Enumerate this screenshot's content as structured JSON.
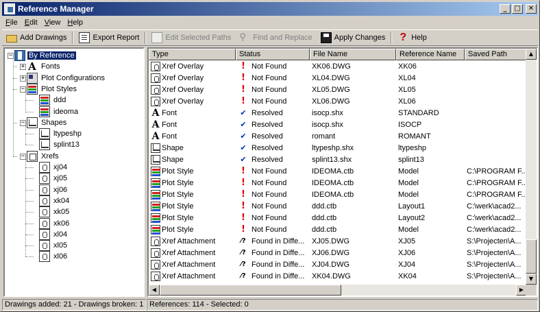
{
  "window": {
    "title": "Reference Manager",
    "minimize": "_",
    "maximize": "□",
    "close": "✕"
  },
  "menu": [
    {
      "label": "File",
      "u": "F",
      "rest": "ile"
    },
    {
      "label": "Edit",
      "u": "E",
      "rest": "dit"
    },
    {
      "label": "View",
      "u": "V",
      "rest": "iew"
    },
    {
      "label": "Help",
      "u": "H",
      "rest": "elp"
    }
  ],
  "toolbar": {
    "add_drawings": "Add Drawings",
    "export_report": "Export Report",
    "edit_paths": "Edit Selected Paths",
    "find_replace": "Find and Replace",
    "apply_changes": "Apply Changes",
    "help": "Help"
  },
  "tree": [
    {
      "label": "By Reference",
      "level": 0,
      "exp": "−",
      "icon": "ref",
      "selected": true
    },
    {
      "label": "Fonts",
      "level": 1,
      "exp": "+",
      "icon": "font"
    },
    {
      "label": "Plot Configurations",
      "level": 1,
      "exp": "+",
      "icon": "plotcfg"
    },
    {
      "label": "Plot Styles",
      "level": 1,
      "exp": "−",
      "icon": "pstyle"
    },
    {
      "label": "ddd",
      "level": 2,
      "icon": "pstyle"
    },
    {
      "label": "ideoma",
      "level": 2,
      "icon": "pstyle"
    },
    {
      "label": "Shapes",
      "level": 1,
      "exp": "−",
      "icon": "shape"
    },
    {
      "label": "ltypeshp",
      "level": 2,
      "icon": "shape"
    },
    {
      "label": "splint13",
      "level": 2,
      "icon": "shape"
    },
    {
      "label": "Xrefs",
      "level": 1,
      "exp": "−",
      "icon": "xrefs"
    },
    {
      "label": "xj04",
      "level": 2,
      "icon": "xref"
    },
    {
      "label": "xj05",
      "level": 2,
      "icon": "xref"
    },
    {
      "label": "xj06",
      "level": 2,
      "icon": "xref"
    },
    {
      "label": "xk04",
      "level": 2,
      "icon": "xref"
    },
    {
      "label": "xk05",
      "level": 2,
      "icon": "xref"
    },
    {
      "label": "xk06",
      "level": 2,
      "icon": "xref"
    },
    {
      "label": "xl04",
      "level": 2,
      "icon": "xref"
    },
    {
      "label": "xl05",
      "level": 2,
      "icon": "xref"
    },
    {
      "label": "xl06",
      "level": 2,
      "icon": "xref"
    }
  ],
  "columns": [
    "Type",
    "Status",
    "File Name",
    "Reference Name",
    "Saved Path"
  ],
  "rows": [
    {
      "type": "Xref Overlay",
      "icon": "xref",
      "status": "Not Found",
      "st": "notfound",
      "file": "XK06.DWG",
      "ref": "XK06",
      "path": ""
    },
    {
      "type": "Xref Overlay",
      "icon": "xref",
      "status": "Not Found",
      "st": "notfound",
      "file": "XL04.DWG",
      "ref": "XL04",
      "path": ""
    },
    {
      "type": "Xref Overlay",
      "icon": "xref",
      "status": "Not Found",
      "st": "notfound",
      "file": "XL05.DWG",
      "ref": "XL05",
      "path": ""
    },
    {
      "type": "Xref Overlay",
      "icon": "xref",
      "status": "Not Found",
      "st": "notfound",
      "file": "XL06.DWG",
      "ref": "XL06",
      "path": ""
    },
    {
      "type": "Font",
      "icon": "font",
      "status": "Resolved",
      "st": "resolved",
      "file": "isocp.shx",
      "ref": "STANDARD",
      "path": ""
    },
    {
      "type": "Font",
      "icon": "font",
      "status": "Resolved",
      "st": "resolved",
      "file": "isocp.shx",
      "ref": "ISOCP",
      "path": ""
    },
    {
      "type": "Font",
      "icon": "font",
      "status": "Resolved",
      "st": "resolved",
      "file": "romant",
      "ref": "ROMANT",
      "path": ""
    },
    {
      "type": "Shape",
      "icon": "shape",
      "status": "Resolved",
      "st": "resolved",
      "file": "ltypeshp.shx",
      "ref": "ltypeshp",
      "path": ""
    },
    {
      "type": "Shape",
      "icon": "shape",
      "status": "Resolved",
      "st": "resolved",
      "file": "splint13.shx",
      "ref": "splint13",
      "path": ""
    },
    {
      "type": "Plot Style",
      "icon": "pstyle",
      "status": "Not Found",
      "st": "notfound",
      "file": "IDEOMA.ctb",
      "ref": "Model",
      "path": "C:\\PROGRAM F..."
    },
    {
      "type": "Plot Style",
      "icon": "pstyle",
      "status": "Not Found",
      "st": "notfound",
      "file": "IDEOMA.ctb",
      "ref": "Model",
      "path": "C:\\PROGRAM F..."
    },
    {
      "type": "Plot Style",
      "icon": "pstyle",
      "status": "Not Found",
      "st": "notfound",
      "file": "IDEOMA.ctb",
      "ref": "Model",
      "path": "C:\\PROGRAM F..."
    },
    {
      "type": "Plot Style",
      "icon": "pstyle",
      "status": "Not Found",
      "st": "notfound",
      "file": "ddd.ctb",
      "ref": "Layout1",
      "path": "C:\\werk\\acad2..."
    },
    {
      "type": "Plot Style",
      "icon": "pstyle",
      "status": "Not Found",
      "st": "notfound",
      "file": "ddd.ctb",
      "ref": "Layout2",
      "path": "C:\\werk\\acad2..."
    },
    {
      "type": "Plot Style",
      "icon": "pstyle",
      "status": "Not Found",
      "st": "notfound",
      "file": "ddd.ctb",
      "ref": "Model",
      "path": "C:\\werk\\acad2..."
    },
    {
      "type": "Xref Attachment",
      "icon": "xref",
      "status": "Found in Diffe...",
      "st": "found",
      "file": "XJ05.DWG",
      "ref": "XJ05",
      "path": "S:\\Projecten\\A..."
    },
    {
      "type": "Xref Attachment",
      "icon": "xref",
      "status": "Found in Diffe...",
      "st": "found",
      "file": "XJ06.DWG",
      "ref": "XJ06",
      "path": "S:\\Projecten\\A..."
    },
    {
      "type": "Xref Attachment",
      "icon": "xref",
      "status": "Found in Diffe...",
      "st": "found",
      "file": "XJ04.DWG",
      "ref": "XJ04",
      "path": "S:\\Projecten\\A..."
    },
    {
      "type": "Xref Attachment",
      "icon": "xref",
      "status": "Found in Diffe...",
      "st": "found",
      "file": "XK04.DWG",
      "ref": "XK04",
      "path": "S:\\Projecten\\A..."
    }
  ],
  "status_glyphs": {
    "notfound": "!",
    "resolved": "✔",
    "found": "⁄?"
  },
  "statusbar": {
    "left": "Drawings added: 21 - Drawings broken: 1",
    "right": "References: 114 - Selected: 0"
  }
}
